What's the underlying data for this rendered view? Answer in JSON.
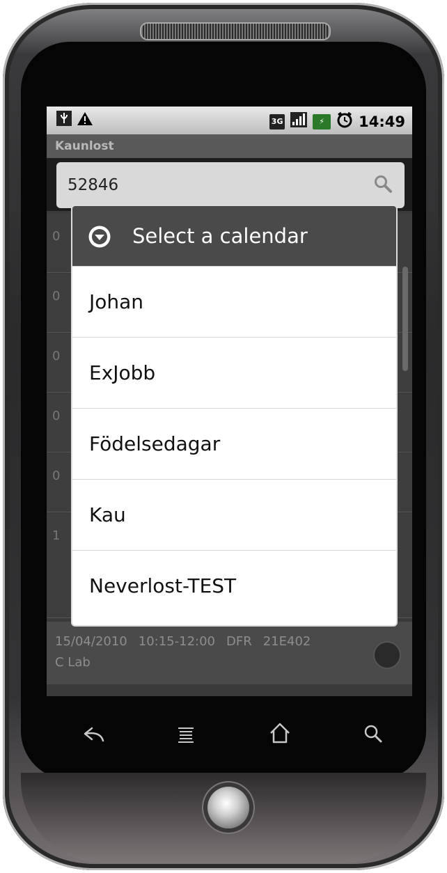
{
  "status_bar": {
    "time": "14:49",
    "left_icons": [
      "usb-icon",
      "warning-icon"
    ],
    "right_icons": [
      "network-3g-icon",
      "signal-icon",
      "battery-icon",
      "alarm-icon"
    ]
  },
  "app": {
    "title": "Kaunlost"
  },
  "search": {
    "query": "52846"
  },
  "background_list": {
    "row_indices": [
      "0",
      "0",
      "0",
      "0",
      "0",
      "1"
    ],
    "bottom_row": {
      "date": "15/04/2010",
      "time": "10:15-12:00",
      "code": "DFR",
      "room": "21E402",
      "description": "C Lab"
    }
  },
  "dialog": {
    "title": "Select a calendar",
    "items": [
      "Johan",
      "ExJobb",
      "Födelsedagar",
      "Kau",
      "Neverlost-TEST"
    ]
  },
  "nav_buttons": [
    "back-icon",
    "menu-icon",
    "home-icon",
    "search-icon"
  ]
}
